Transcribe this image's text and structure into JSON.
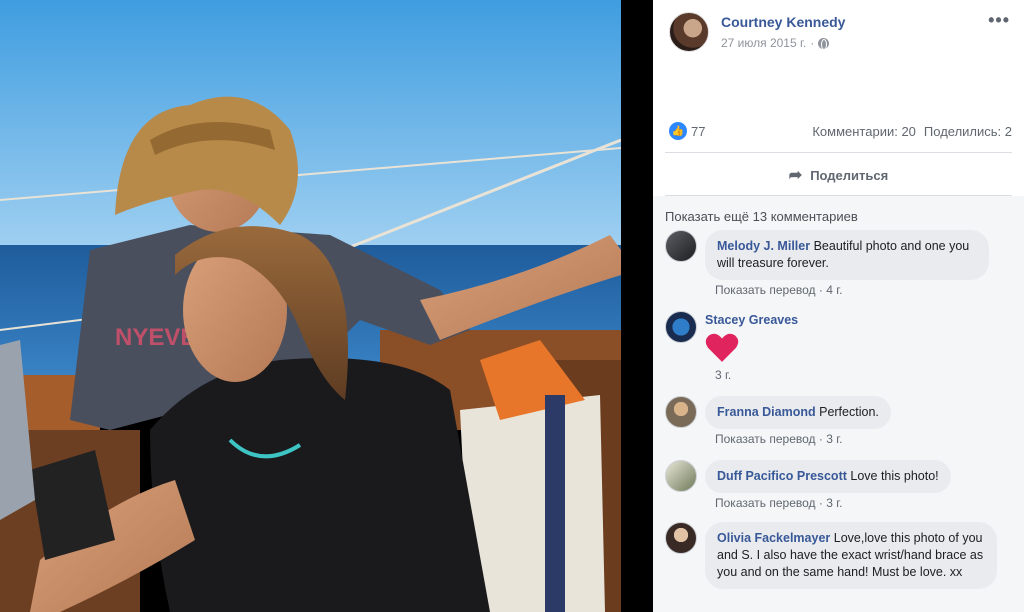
{
  "post": {
    "author": "Courtney Kennedy",
    "date": "27 июля 2015 г.",
    "meta_sep": "·",
    "more": "•••"
  },
  "stats": {
    "likes": "77",
    "comments": "Комментарии: 20",
    "shares": "Поделились: 2"
  },
  "actions": {
    "share_label": "Поделиться"
  },
  "comments_section": {
    "show_more": "Показать ещё 13 комментариев",
    "items": [
      {
        "name": "Melody J. Miller",
        "text": "Beautiful photo and one you will treasure forever.",
        "translate": "Показать перевод",
        "time": "4 г."
      },
      {
        "name": "Stacey Greaves",
        "text": "",
        "translate": "",
        "time": "3 г."
      },
      {
        "name": "Franna Diamond",
        "text": "Perfection.",
        "translate": "Показать перевод",
        "time": "3 г."
      },
      {
        "name": "Duff Pacifico Prescott",
        "text": "Love this photo!",
        "translate": "Показать перевод",
        "time": "3 г."
      },
      {
        "name": "Olivia Fackelmayer",
        "text": "Love,love this photo of you and S. I also have the exact wrist/hand brace as you and on the same hand! Must be love. xx",
        "translate": "",
        "time": ""
      }
    ]
  },
  "photo": {
    "shirt_text": "NYEVE"
  },
  "colors": {
    "link": "#385898",
    "like_blue": "#2d88ff",
    "bubble": "#e9ebee",
    "heart": "#e0245e"
  }
}
